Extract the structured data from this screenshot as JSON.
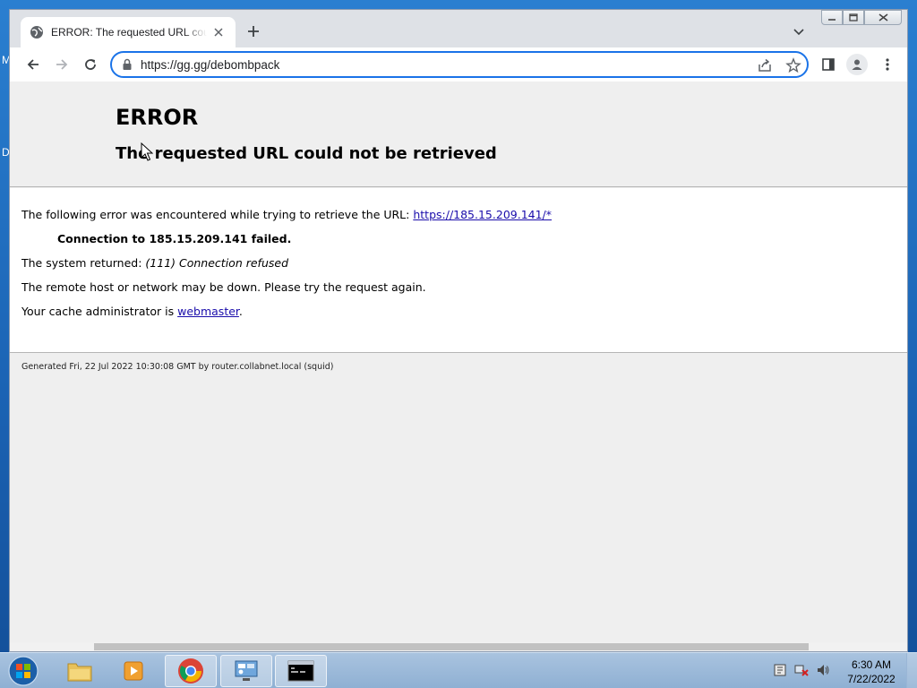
{
  "desktop": {
    "letters": [
      "M",
      "D"
    ]
  },
  "browser": {
    "tab": {
      "title": "ERROR: The requested URL could not be retrieved"
    },
    "omnibox": {
      "url": "https://gg.gg/debombpack"
    }
  },
  "page": {
    "title": "ERROR",
    "subtitle": "The requested URL could not be retrieved",
    "line1_text": "The following error was encountered while trying to retrieve the URL: ",
    "line1_link": "https://185.15.209.141/*",
    "line2": "Connection to 185.15.209.141 failed.",
    "line3_text": "The system returned: ",
    "line3_italic": "(111) Connection refused",
    "line4": "The remote host or network may be down. Please try the request again.",
    "line5_text": "Your cache administrator is ",
    "line5_link": "webmaster",
    "line5_end": ".",
    "footer": "Generated Fri, 22 Jul 2022 10:30:08 GMT by router.collabnet.local (squid)"
  },
  "taskbar": {
    "clock_time": "6:30 AM",
    "clock_date": "7/22/2022"
  }
}
